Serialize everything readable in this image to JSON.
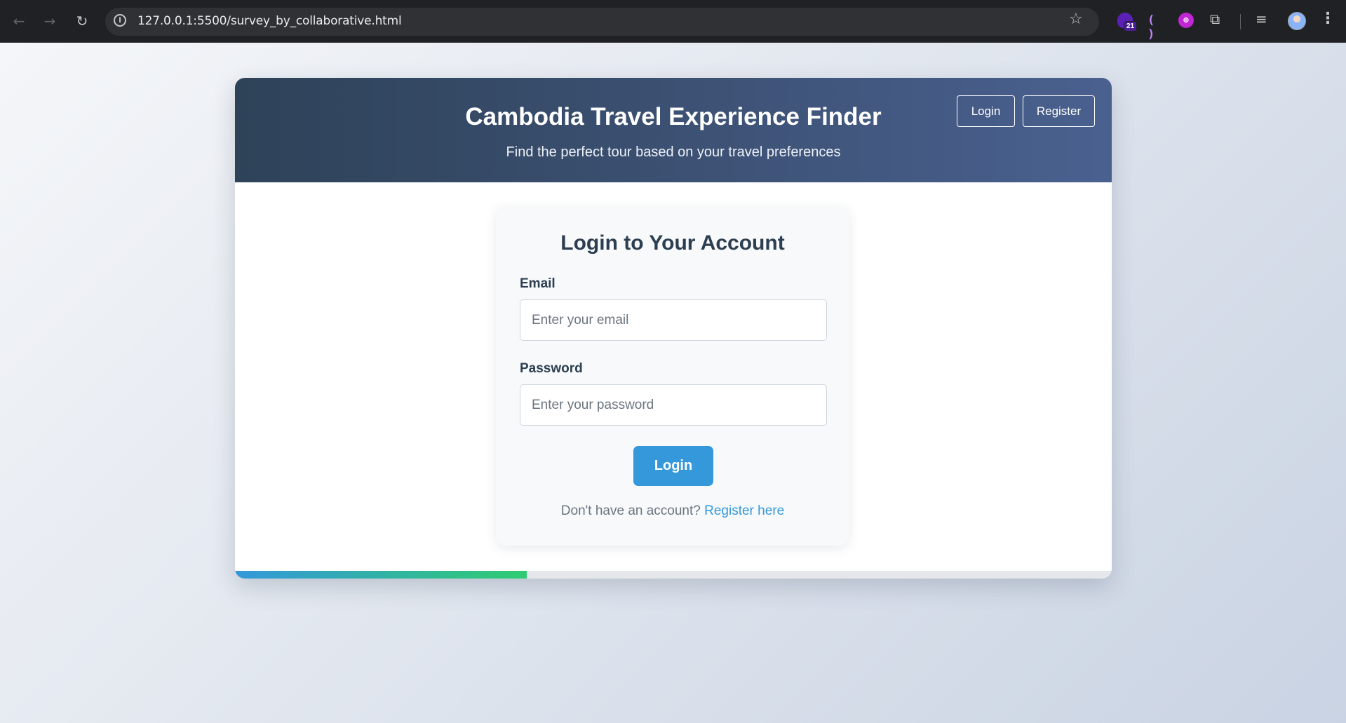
{
  "browser": {
    "url": "127.0.0.1:5500/survey_by_collaborative.html",
    "extension_badge": "21",
    "icons": [
      "back-arrow-icon",
      "forward-arrow-icon",
      "reload-icon",
      "site-info-icon",
      "bookmark-star-icon",
      "wallet-extension-icon",
      "paren-extension-icon",
      "circle-extension-icon",
      "extensions-puzzle-icon",
      "media-controls-icon",
      "profile-avatar",
      "menu-kebab-icon"
    ]
  },
  "header": {
    "title": "Cambodia Travel Experience Finder",
    "subtitle": "Find the perfect tour based on your travel preferences",
    "login_label": "Login",
    "register_label": "Register"
  },
  "login": {
    "title": "Login to Your Account",
    "email_label": "Email",
    "email_placeholder": "Enter your email",
    "email_value": "",
    "password_label": "Password",
    "password_placeholder": "Enter your password",
    "password_value": "",
    "submit_label": "Login",
    "footer_text": "Don't have an account?",
    "register_link": "Register here"
  },
  "progress": {
    "value": 0.333
  },
  "colors": {
    "header_start": "#2e4258",
    "header_end": "#4a6190",
    "accent": "#3498db",
    "progress_end": "#2ecc71",
    "heading_text": "#2c3e50"
  }
}
